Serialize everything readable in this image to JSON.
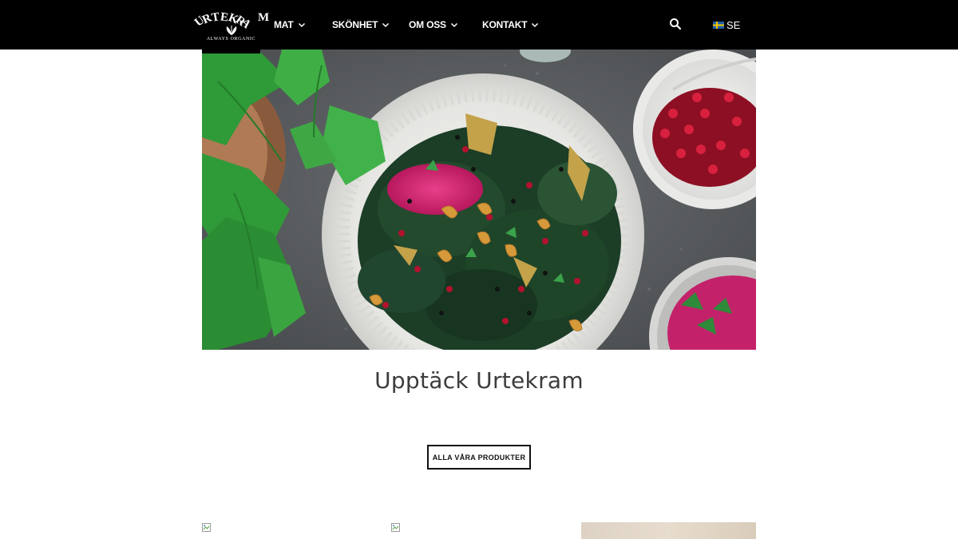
{
  "brand": {
    "logo_text": "URTEKRAM",
    "logo_letters": [
      "U",
      "R",
      "T",
      "E",
      "K",
      "R",
      "A",
      "M"
    ],
    "tagline": "ALWAYS ORGANIC"
  },
  "nav": {
    "items": [
      {
        "label": "MAT"
      },
      {
        "label": "SKÖNHET"
      },
      {
        "label": "OM OSS"
      },
      {
        "label": "KONTAKT"
      }
    ],
    "language": {
      "code": "SE",
      "flag": "sweden-flag"
    }
  },
  "hero": {
    "image": "salad-bowl-photo"
  },
  "main": {
    "heading": "Upptäck Urtekram",
    "cta_label": "ALLA VÅRA PRODUKTER"
  },
  "colors": {
    "navbar_bg": "#000000",
    "heading": "#3c3c3c",
    "button_border": "#111111"
  }
}
